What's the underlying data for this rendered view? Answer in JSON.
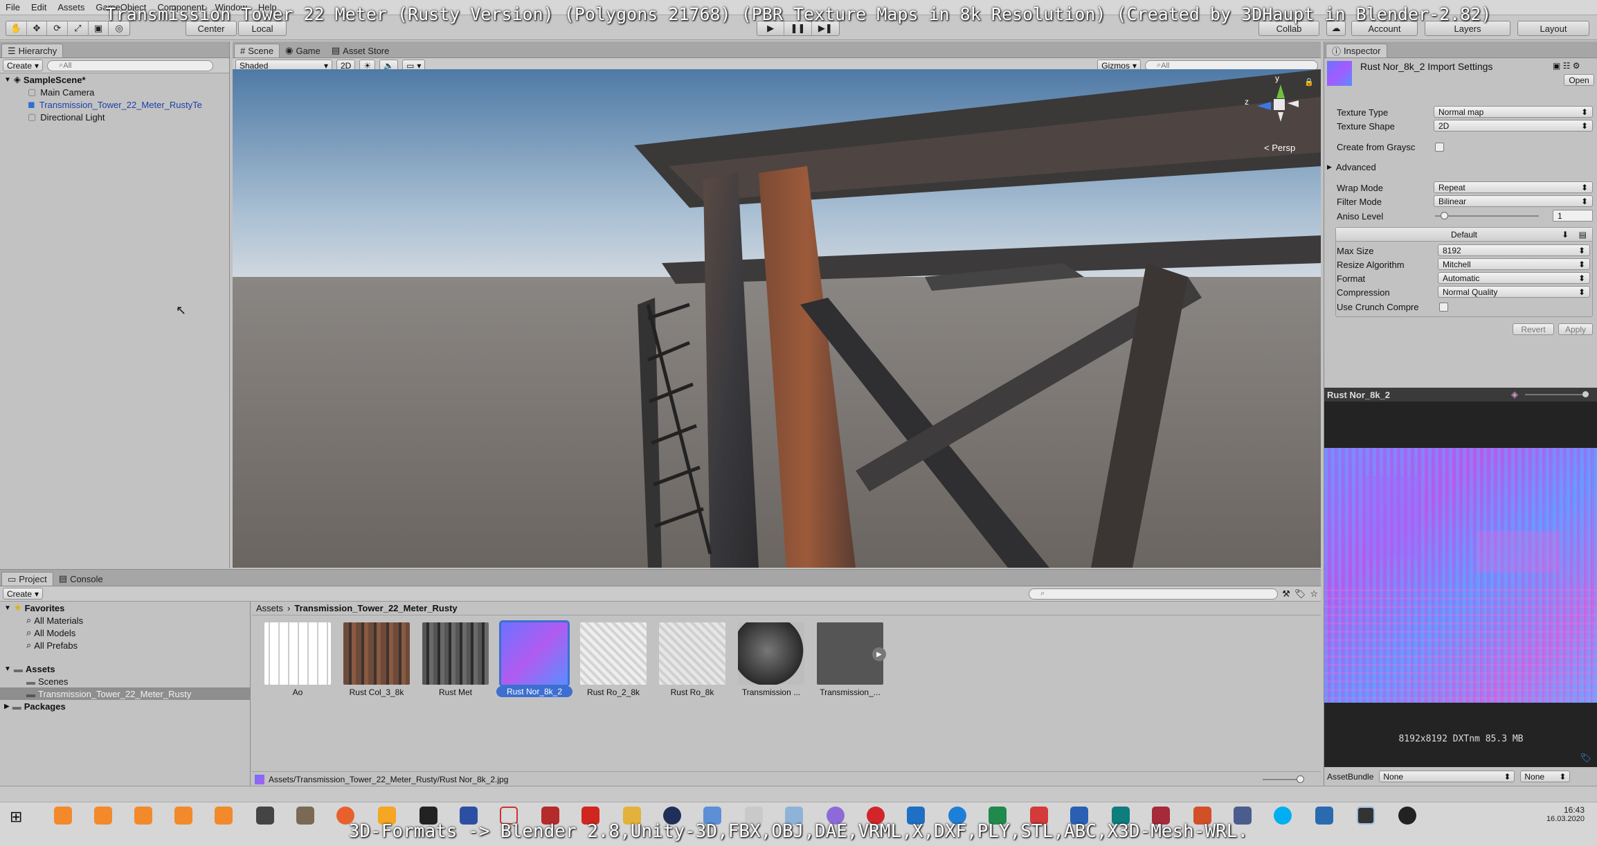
{
  "overlay": {
    "title": "Transmission Tower 22 Meter (Rusty Version) (Polygons 21768) (PBR Texture Maps in 8k Resolution) (Created by 3DHaupt in Blender-2.82)",
    "bottom": "3D-Formats -> Blender 2.8,Unity-3D,FBX,OBJ,DAE,VRML,X,DXF,PLY,STL,ABC,X3D-Mesh-WRL."
  },
  "menu": [
    "File",
    "Edit",
    "Assets",
    "GameObject",
    "Component",
    "Window",
    "Help"
  ],
  "toolbar": {
    "pivot": "Center",
    "space": "Local",
    "collab": "Collab",
    "account": "Account",
    "layers": "Layers",
    "layout": "Layout"
  },
  "hierarchy": {
    "tab": "Hierarchy",
    "create": "Create",
    "search_placeholder": "All",
    "scene": "SampleScene*",
    "items": [
      "Main Camera",
      "Transmission_Tower_22_Meter_RustyTe",
      "Directional Light"
    ]
  },
  "scene": {
    "tabs": [
      "Scene",
      "Game",
      "Asset Store"
    ],
    "shading": "Shaded",
    "mode_2d": "2D",
    "gizmos": "Gizmos",
    "search_placeholder": "All",
    "persp": "Persp",
    "axis_y": "y",
    "axis_z": "z"
  },
  "inspector": {
    "tab": "Inspector",
    "asset_title": "Rust Nor_8k_2 Import Settings",
    "open": "Open",
    "rows": [
      {
        "label": "Texture Type",
        "value": "Normal map"
      },
      {
        "label": "Texture Shape",
        "value": "2D"
      }
    ],
    "create_from_grayscale": "Create from Graysc",
    "advanced": "Advanced",
    "wrap_mode": {
      "label": "Wrap Mode",
      "value": "Repeat"
    },
    "filter_mode": {
      "label": "Filter Mode",
      "value": "Bilinear"
    },
    "aniso": {
      "label": "Aniso Level",
      "value": "1"
    },
    "platform": "Default",
    "platform_rows": [
      {
        "label": "Max Size",
        "value": "8192"
      },
      {
        "label": "Resize Algorithm",
        "value": "Mitchell"
      },
      {
        "label": "Format",
        "value": "Automatic"
      },
      {
        "label": "Compression",
        "value": "Normal Quality"
      }
    ],
    "crunch": "Use Crunch Compre",
    "revert": "Revert",
    "apply": "Apply"
  },
  "preview": {
    "title": "Rust Nor_8k_2",
    "info": "8192x8192  DXTnm  85.3 MB",
    "assetbundle_label": "AssetBundle",
    "assetbundle_value": "None",
    "variant_value": "None"
  },
  "project": {
    "tabs": [
      "Project",
      "Console"
    ],
    "create": "Create",
    "favorites": "Favorites",
    "favorite_items": [
      "All Materials",
      "All Models",
      "All Prefabs"
    ],
    "assets": "Assets",
    "asset_folders": [
      "Scenes",
      "Transmission_Tower_22_Meter_Rusty"
    ],
    "packages": "Packages",
    "breadcrumb_root": "Assets",
    "breadcrumb_current": "Transmission_Tower_22_Meter_Rusty",
    "thumbnails": [
      "Ao",
      "Rust Col_3_8k",
      "Rust Met",
      "Rust Nor_8k_2",
      "Rust Ro_2_8k",
      "Rust Ro_8k",
      "Transmission ...",
      "Transmission_..."
    ],
    "status_path": "Assets/Transmission_Tower_22_Meter_Rusty/Rust Nor_8k_2.jpg"
  },
  "taskbar": {
    "time": "16:43",
    "date": "16.03.2020"
  },
  "colors": {
    "selection": "#3d6fd1",
    "panel": "#c2c2c2",
    "normal_map_purple": "#8a6bff"
  }
}
